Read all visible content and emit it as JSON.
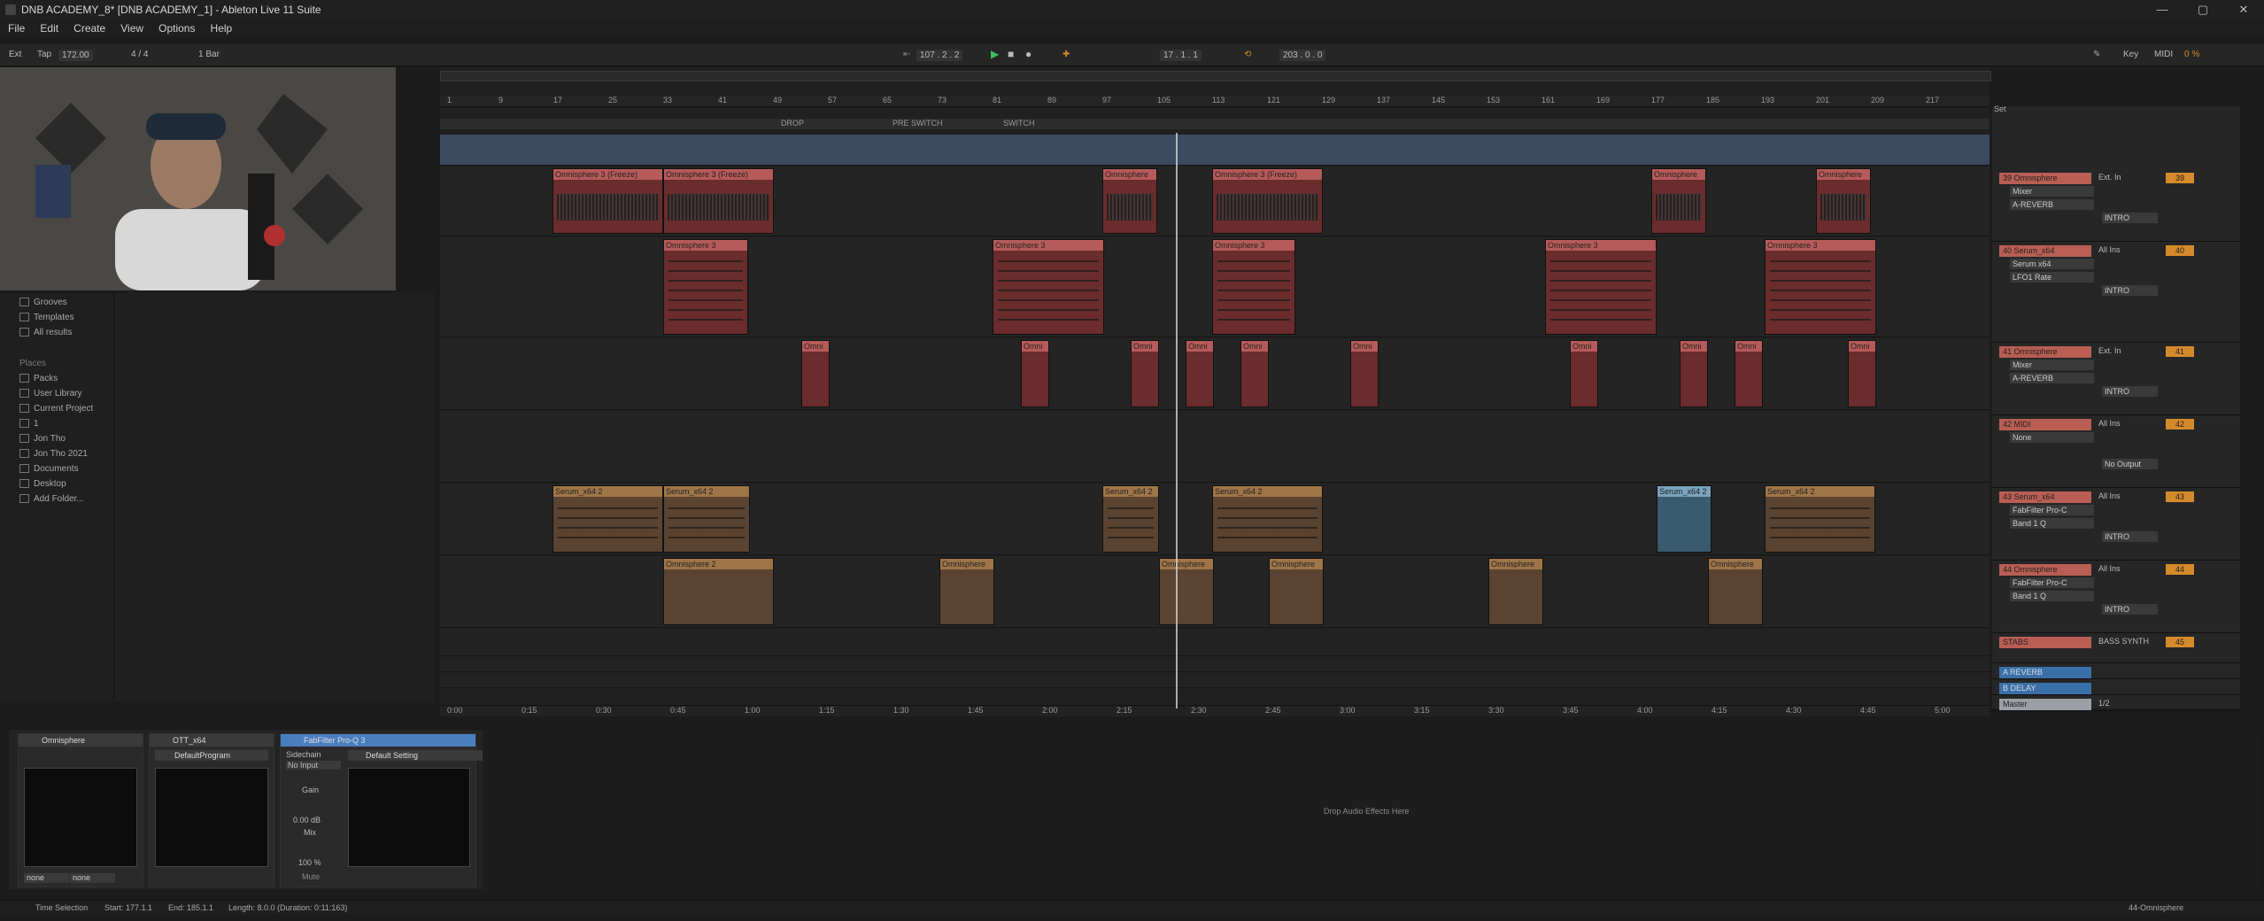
{
  "window": {
    "title": "DNB ACADEMY_8* [DNB ACADEMY_1] - Ableton Live 11 Suite",
    "minimize": "—",
    "maximize": "▢",
    "close": "✕"
  },
  "menu": [
    "File",
    "Edit",
    "Create",
    "View",
    "Options",
    "Help"
  ],
  "control": {
    "ext": "Ext",
    "tap": "Tap",
    "tempo": "172.00",
    "time_sig": "4 / 4",
    "quantize": "1 Bar",
    "position": "107 . 2 . 2",
    "loop_start": "17 . 1 . 1",
    "loop_length": "203 . 0 . 0",
    "key": "Key",
    "midi": "MIDI",
    "cpu": "0 %"
  },
  "browser": {
    "collections": [
      "Grooves",
      "Templates",
      "All results"
    ],
    "places_heading": "Places",
    "places": [
      "Packs",
      "User Library",
      "Current Project",
      "1",
      "Jon Tho",
      "Jon Tho 2021",
      "Documents",
      "Desktop",
      "Add Folder..."
    ]
  },
  "ruler": {
    "bars": [
      "1",
      "9",
      "17",
      "25",
      "33",
      "41",
      "49",
      "57",
      "65",
      "73",
      "81",
      "89",
      "97",
      "105",
      "113",
      "121",
      "129",
      "137",
      "145",
      "153",
      "161",
      "169",
      "177",
      "185",
      "193",
      "201",
      "209",
      "217"
    ],
    "times": [
      "0:00",
      "0:15",
      "0:30",
      "0:45",
      "1:00",
      "1:15",
      "1:30",
      "1:45",
      "2:00",
      "2:15",
      "2:30",
      "2:45",
      "3:00",
      "3:15",
      "3:30",
      "3:45",
      "4:00",
      "4:15",
      "4:30",
      "4:45",
      "5:00"
    ]
  },
  "locators": [
    "DROP",
    "PRE SWITCH",
    "SWITCH"
  ],
  "clips": {
    "omni_freeze": "Omnisphere 3 (Freeze)",
    "omni3": "Omnisphere 3",
    "omni": "Omnisphere",
    "omni2": "Omnisphere 2",
    "serum": "Serum_x64 2",
    "omni_short": "Omni"
  },
  "mixer": {
    "set_label": "Set",
    "tracks": [
      {
        "name": "39 Omnisphere",
        "input": "Ext. In",
        "num": "39",
        "dev1": "Mixer",
        "dev2": "A-REVERB",
        "route": "INTRO"
      },
      {
        "name": "40 Serum_x64",
        "input": "All Ins",
        "num": "40",
        "dev1": "Serum x64",
        "dev2": "LFO1 Rate",
        "route": "INTRO"
      },
      {
        "name": "41 Omnisphere",
        "input": "Ext. In",
        "num": "41",
        "dev1": "Mixer",
        "dev2": "A-REVERB",
        "route": "INTRO"
      },
      {
        "name": "42 MIDI",
        "input": "All Ins",
        "num": "42",
        "dev1": "None",
        "dev2": "",
        "route": "No Output"
      },
      {
        "name": "43 Serum_x64",
        "input": "All Ins",
        "num": "43",
        "dev1": "FabFilter Pro-C",
        "dev2": "Band 1 Q",
        "route": "INTRO"
      },
      {
        "name": "44 Omnisphere",
        "input": "All Ins",
        "num": "44",
        "dev1": "FabFilter Pro-C",
        "dev2": "Band 1 Q",
        "route": "INTRO"
      },
      {
        "name": "STABS",
        "input": "BASS SYNTH",
        "num": "45",
        "dev1": "",
        "dev2": "",
        "route": ""
      }
    ],
    "returns": [
      "A REVERB",
      "B DELAY",
      "Master"
    ],
    "master_val": "1/2"
  },
  "devices": [
    {
      "name": "Omnisphere",
      "program": ""
    },
    {
      "name": "OTT_x64",
      "program": "DefaultProgram"
    },
    {
      "name": "FabFilter Pro-Q 3",
      "program": "Default Setting",
      "sidechain": "Sidechain",
      "no_input": "No Input",
      "gain": "Gain",
      "gain_val": "0.00 dB",
      "mix": "Mix",
      "mix_val": "100 %",
      "mute": "Mute"
    }
  ],
  "drop_hint": "Drop Audio Effects Here",
  "status": {
    "mode": "Time Selection",
    "start": "Start: 177.1.1",
    "end": "End: 185.1.1",
    "length": "Length: 8.0.0 (Duration: 0:11:163)",
    "track": "44-Omnisphere"
  }
}
